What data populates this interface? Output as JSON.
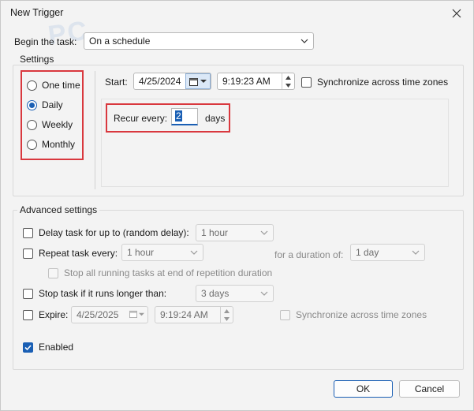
{
  "window": {
    "title": "New Trigger"
  },
  "watermark": "PC",
  "begin": {
    "label": "Begin the task:",
    "value": "On a schedule"
  },
  "settings": {
    "title": "Settings",
    "options": [
      "One time",
      "Daily",
      "Weekly",
      "Monthly"
    ],
    "selected": "Daily",
    "start_label": "Start:",
    "start_date": "4/25/2024",
    "start_time": "9:19:23 AM",
    "sync_label": "Synchronize across time zones",
    "recur_label": "Recur every:",
    "recur_value": "2",
    "recur_unit": "days"
  },
  "advanced": {
    "title": "Advanced settings",
    "delay_label": "Delay task for up to (random delay):",
    "delay_value": "1 hour",
    "repeat_label": "Repeat task every:",
    "repeat_value": "1 hour",
    "duration_label": "for a duration of:",
    "duration_value": "1 day",
    "stop_running_label": "Stop all running tasks at end of repetition duration",
    "stop_longer_label": "Stop task if it runs longer than:",
    "stop_longer_value": "3 days",
    "expire_label": "Expire:",
    "expire_date": "4/25/2025",
    "expire_time": "9:19:24 AM",
    "expire_sync_label": "Synchronize across time zones",
    "enabled_label": "Enabled"
  },
  "buttons": {
    "ok": "OK",
    "cancel": "Cancel"
  },
  "colors": {
    "accent": "#1a5fb4",
    "highlight": "#d9383e"
  }
}
